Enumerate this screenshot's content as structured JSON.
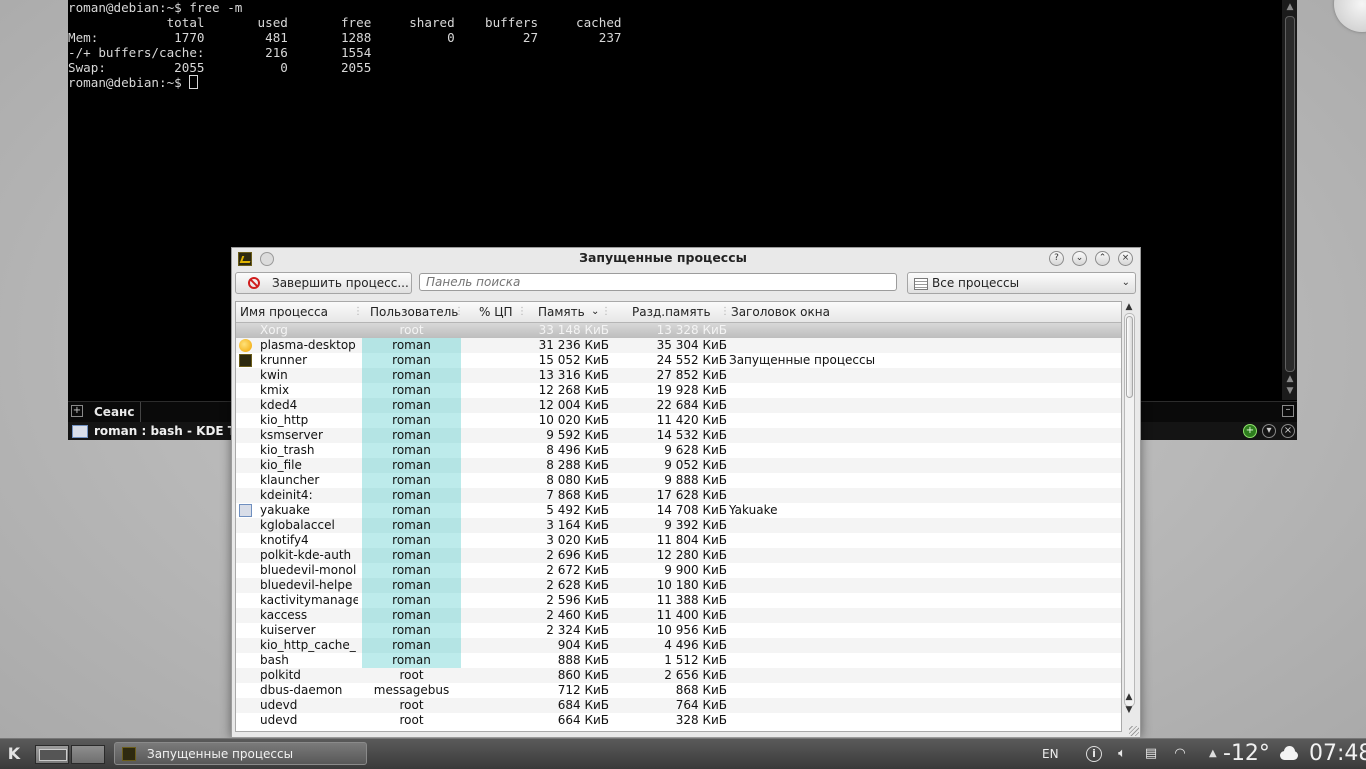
{
  "terminal": {
    "lines": [
      "roman@debian:~$ free -m",
      "             total       used       free     shared    buffers     cached",
      "Mem:          1770        481       1288          0         27        237",
      "-/+ buffers/cache:        216       1554",
      "Swap:         2055          0       2055",
      "roman@debian:~$ "
    ],
    "tab_label": "Сеанс",
    "window_title": "roman : bash - KDE Ter"
  },
  "window": {
    "title": "Запущенные процессы",
    "kill_button": "Завершить процесс...",
    "search_placeholder": "Панель поиска",
    "filter_value": "Все процессы"
  },
  "table": {
    "columns": {
      "name": "Имя процесса",
      "user": "Пользователь",
      "cpu": "% ЦП",
      "memory": "Память",
      "shared": "Разд.память",
      "title": "Заголовок окна"
    },
    "rows": [
      {
        "name": "Xorg",
        "user": "root",
        "cpu": "",
        "mem": "33 148 КиБ",
        "shared": "13 328 КиБ",
        "title": "",
        "icon": "",
        "selected": true
      },
      {
        "name": "plasma-desktop",
        "user": "roman",
        "cpu": "",
        "mem": "31 236 КиБ",
        "shared": "35 304 КиБ",
        "title": "",
        "icon": "plasma"
      },
      {
        "name": "krunner",
        "user": "roman",
        "cpu": "",
        "mem": "15 052 КиБ",
        "shared": "24 552 КиБ",
        "title": "Запущенные процессы",
        "icon": "krunner"
      },
      {
        "name": "kwin",
        "user": "roman",
        "cpu": "",
        "mem": "13 316 КиБ",
        "shared": "27 852 КиБ",
        "title": "",
        "icon": ""
      },
      {
        "name": "kmix",
        "user": "roman",
        "cpu": "",
        "mem": "12 268 КиБ",
        "shared": "19 928 КиБ",
        "title": "",
        "icon": ""
      },
      {
        "name": "kded4",
        "user": "roman",
        "cpu": "",
        "mem": "12 004 КиБ",
        "shared": "22 684 КиБ",
        "title": "",
        "icon": ""
      },
      {
        "name": "kio_http",
        "user": "roman",
        "cpu": "",
        "mem": "10 020 КиБ",
        "shared": "11 420 КиБ",
        "title": "",
        "icon": ""
      },
      {
        "name": "ksmserver",
        "user": "roman",
        "cpu": "",
        "mem": "9 592 КиБ",
        "shared": "14 532 КиБ",
        "title": "",
        "icon": ""
      },
      {
        "name": "kio_trash",
        "user": "roman",
        "cpu": "",
        "mem": "8 496 КиБ",
        "shared": "9 628 КиБ",
        "title": "",
        "icon": ""
      },
      {
        "name": "kio_file",
        "user": "roman",
        "cpu": "",
        "mem": "8 288 КиБ",
        "shared": "9 052 КиБ",
        "title": "",
        "icon": ""
      },
      {
        "name": "klauncher",
        "user": "roman",
        "cpu": "",
        "mem": "8 080 КиБ",
        "shared": "9 888 КиБ",
        "title": "",
        "icon": ""
      },
      {
        "name": "kdeinit4:",
        "user": "roman",
        "cpu": "",
        "mem": "7 868 КиБ",
        "shared": "17 628 КиБ",
        "title": "",
        "icon": ""
      },
      {
        "name": "yakuake",
        "user": "roman",
        "cpu": "",
        "mem": "5 492 КиБ",
        "shared": "14 708 КиБ",
        "title": "Yakuake",
        "icon": "yakuake"
      },
      {
        "name": "kglobalaccel",
        "user": "roman",
        "cpu": "",
        "mem": "3 164 КиБ",
        "shared": "9 392 КиБ",
        "title": "",
        "icon": ""
      },
      {
        "name": "knotify4",
        "user": "roman",
        "cpu": "",
        "mem": "3 020 КиБ",
        "shared": "11 804 КиБ",
        "title": "",
        "icon": ""
      },
      {
        "name": "polkit-kde-auth",
        "user": "roman",
        "cpu": "",
        "mem": "2 696 КиБ",
        "shared": "12 280 КиБ",
        "title": "",
        "icon": ""
      },
      {
        "name": "bluedevil-monol",
        "user": "roman",
        "cpu": "",
        "mem": "2 672 КиБ",
        "shared": "9 900 КиБ",
        "title": "",
        "icon": ""
      },
      {
        "name": "bluedevil-helpe",
        "user": "roman",
        "cpu": "",
        "mem": "2 628 КиБ",
        "shared": "10 180 КиБ",
        "title": "",
        "icon": ""
      },
      {
        "name": "kactivitymanage",
        "user": "roman",
        "cpu": "",
        "mem": "2 596 КиБ",
        "shared": "11 388 КиБ",
        "title": "",
        "icon": ""
      },
      {
        "name": "kaccess",
        "user": "roman",
        "cpu": "",
        "mem": "2 460 КиБ",
        "shared": "11 400 КиБ",
        "title": "",
        "icon": ""
      },
      {
        "name": "kuiserver",
        "user": "roman",
        "cpu": "",
        "mem": "2 324 КиБ",
        "shared": "10 956 КиБ",
        "title": "",
        "icon": ""
      },
      {
        "name": "kio_http_cache_",
        "user": "roman",
        "cpu": "",
        "mem": "904 КиБ",
        "shared": "4 496 КиБ",
        "title": "",
        "icon": ""
      },
      {
        "name": "bash",
        "user": "roman",
        "cpu": "",
        "mem": "888 КиБ",
        "shared": "1 512 КиБ",
        "title": "",
        "icon": ""
      },
      {
        "name": "polkitd",
        "user": "root",
        "cpu": "",
        "mem": "860 КиБ",
        "shared": "2 656 КиБ",
        "title": "",
        "icon": ""
      },
      {
        "name": "dbus-daemon",
        "user": "messagebus",
        "cpu": "",
        "mem": "712 КиБ",
        "shared": "868 КиБ",
        "title": "",
        "icon": ""
      },
      {
        "name": "udevd",
        "user": "root",
        "cpu": "",
        "mem": "684 КиБ",
        "shared": "764 КиБ",
        "title": "",
        "icon": ""
      },
      {
        "name": "udevd",
        "user": "root",
        "cpu": "",
        "mem": "664 КиБ",
        "shared": "328 КиБ",
        "title": "",
        "icon": ""
      }
    ]
  },
  "taskbar": {
    "kmenu_label": "K",
    "task_label": "Запущенные процессы",
    "keyboard_layout": "EN",
    "temperature": "-12°",
    "clock": "07:48"
  },
  "colors": {
    "user_highlight": "#bdebeb",
    "terminal_bg": "#000000",
    "kill_icon": "#d01e1e"
  }
}
